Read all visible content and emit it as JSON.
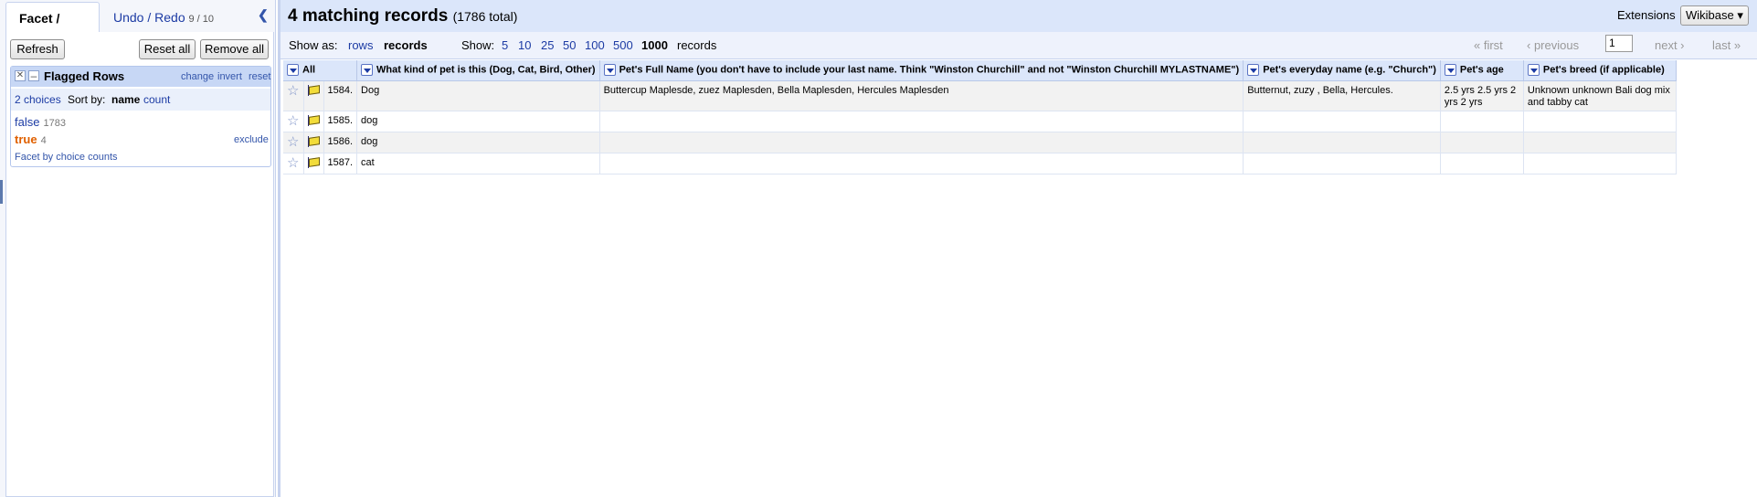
{
  "left": {
    "tabs": {
      "facet": "Facet / Filter",
      "undo": "Undo / Redo",
      "undo_count": "9 / 10"
    },
    "buttons": {
      "refresh": "Refresh",
      "reset_all": "Reset all",
      "remove_all": "Remove all"
    },
    "facet": {
      "title": "Flagged Rows",
      "links": {
        "change": "change",
        "invert": "invert",
        "reset": "reset"
      },
      "choices_count": "2 choices",
      "sort_label": "Sort by:",
      "sort_name": "name",
      "sort_count": "count",
      "choices": [
        {
          "label": "false",
          "count": "1783"
        },
        {
          "label": "true",
          "count": "4"
        }
      ],
      "exclude": "exclude",
      "facet_by_counts": "Facet by choice counts"
    }
  },
  "summary": {
    "title": "4 matching records",
    "total": "(1786 total)"
  },
  "extensions": {
    "label": "Extensions",
    "button": "Wikibase ▾"
  },
  "toolbar": {
    "show_as": "Show as:",
    "rows": "rows",
    "records": "records",
    "show": "Show:",
    "sizes": [
      "5",
      "10",
      "25",
      "50",
      "100",
      "500"
    ],
    "selected_size": "1000",
    "records_suffix": "records",
    "first": "« first",
    "previous": "‹ previous",
    "page": "1",
    "next": "next ›",
    "last": "last »"
  },
  "table": {
    "all_label": "All",
    "columns": [
      "What kind of pet is this (Dog, Cat, Bird, Other)",
      "Pet's Full Name (you don't have to include your last name. Think \"Winston Churchill\" and not \"Winston Churchill MYLASTNAME\")",
      "Pet's everyday name (e.g. \"Church\")",
      "Pet's age",
      "Pet's breed (if applicable)"
    ],
    "rows": [
      {
        "num": "1584.",
        "cells": [
          "Dog",
          "Buttercup Maplesde, zuez Maplesden, Bella Maplesden, Hercules Maplesden",
          "Butternut, zuzy , Bella, Hercules.",
          "2.5 yrs 2.5 yrs 2 yrs 2 yrs",
          "Unknown unknown Bali dog mix and tabby cat"
        ]
      },
      {
        "num": "1585.",
        "cells": [
          " dog",
          "",
          "",
          "",
          ""
        ]
      },
      {
        "num": "1586.",
        "cells": [
          " dog",
          "",
          "",
          "",
          ""
        ]
      },
      {
        "num": "1587.",
        "cells": [
          " cat",
          "",
          "",
          "",
          ""
        ]
      }
    ]
  }
}
